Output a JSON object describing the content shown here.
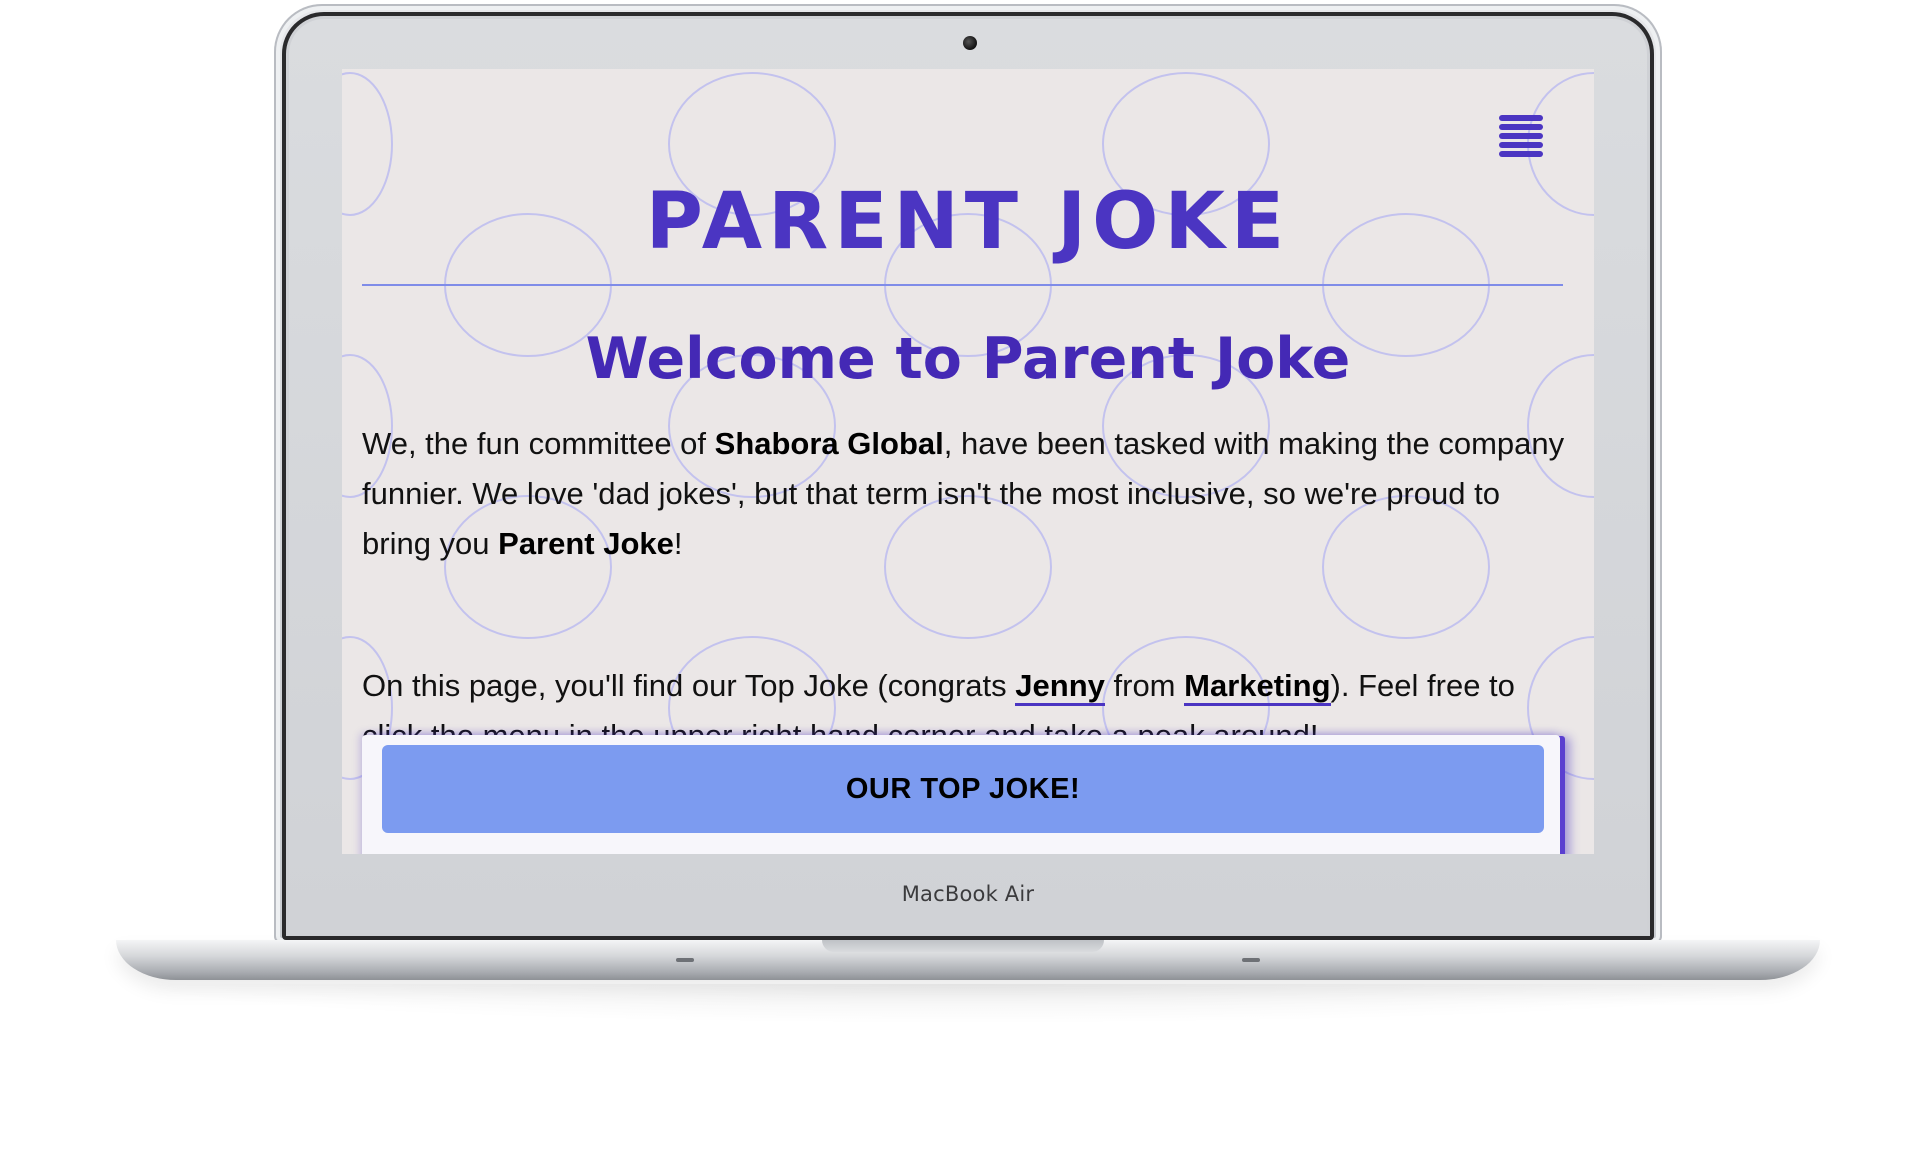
{
  "device": {
    "brand_label": "MacBook Air"
  },
  "site": {
    "title": "PARENT JOKE",
    "menu_icon": "hamburger-menu-icon",
    "accent_color": "#4b35c2",
    "button_color": "#7c9bf0",
    "background_color": "#ebe7e7"
  },
  "welcome": {
    "heading": "Welcome to Parent Joke"
  },
  "intro": {
    "part1": "We, the fun committee of ",
    "company": "Shabora Global",
    "part2": ", have been tasked with making the company funnier. We love 'dad jokes', but that term isn't the most inclusive, so we're proud to bring you ",
    "brand": "Parent Joke",
    "part3": "!"
  },
  "details": {
    "part1": "On this page, you'll find our Top Joke (congrats ",
    "person_link": "Jenny",
    "part2": " from ",
    "department_link": "Marketing",
    "part3": "). Feel free to click the menu in the upper right hand corner and take a peak around!"
  },
  "top_joke": {
    "button_label": "OUR TOP JOKE!"
  }
}
